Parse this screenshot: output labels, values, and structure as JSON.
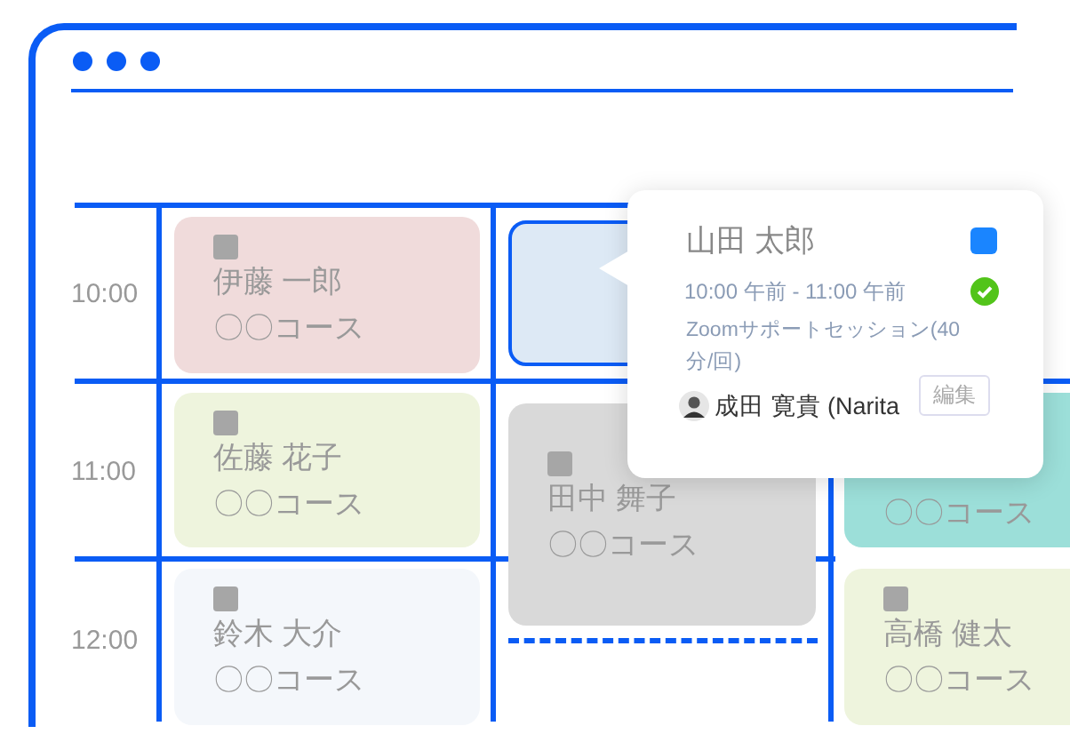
{
  "time_labels": [
    "10:00",
    "11:00",
    "12:00"
  ],
  "events": [
    {
      "name": "伊藤 一郎",
      "course": "〇〇コース",
      "color": "#f0dbdb",
      "selected": false
    },
    {
      "name": "佐藤 花子",
      "course": "〇〇コース",
      "color": "#eef4dd",
      "selected": false
    },
    {
      "name": "鈴木 大介",
      "course": "〇〇コース",
      "color": "#f4f7fb",
      "selected": false
    },
    {
      "color": "#dde9f5",
      "selected": true
    },
    {
      "name": "田中 舞子",
      "course": "〇〇コース",
      "color": "#d9d9d9",
      "selected": false
    },
    {
      "course": "〇〇コース",
      "color": "#9cdfd9",
      "selected": false
    },
    {
      "name": "高橋 健太",
      "course": "〇〇コース",
      "color": "#eef4dd",
      "selected": false
    }
  ],
  "popover": {
    "name": "山田 太郎",
    "color": "#1a85ff",
    "time": "10:00 午前 - 11:00 午前",
    "confirmed": true,
    "description": "Zoomサポートセッション(40 分/回)",
    "host": "成田 寛貴 (Narita",
    "edit_button": "編集"
  }
}
